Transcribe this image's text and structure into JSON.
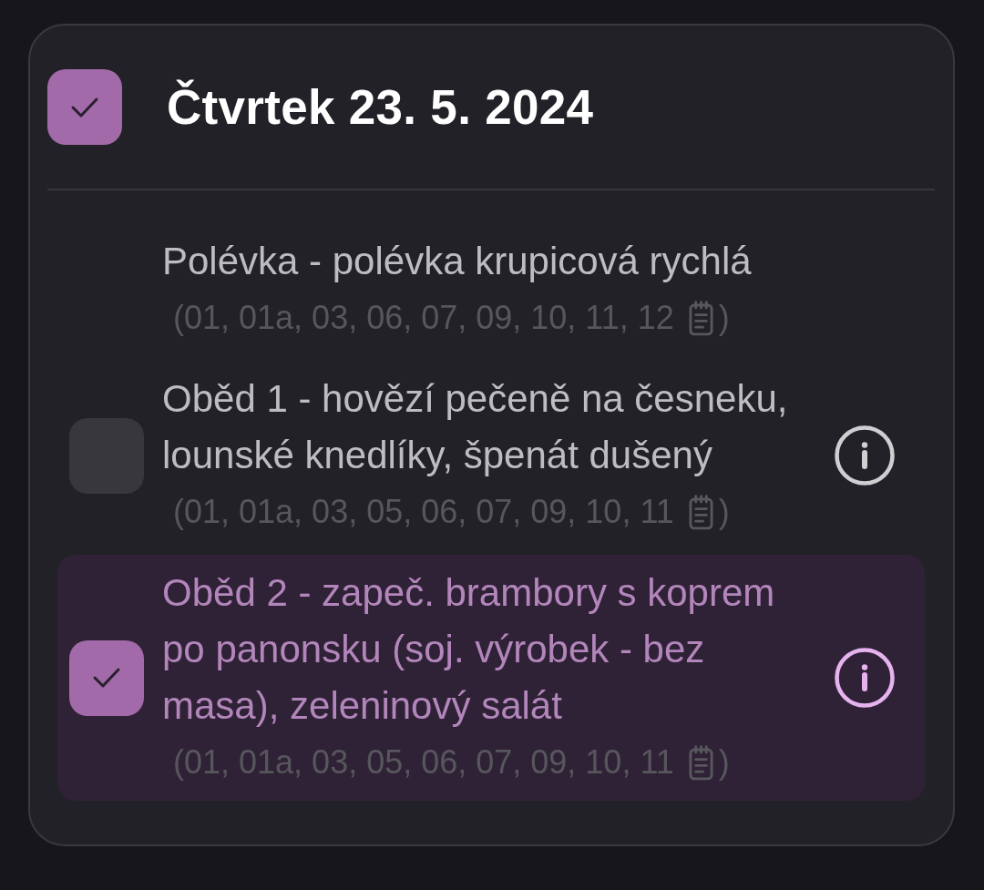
{
  "day": {
    "title": "Čtvrtek 23. 5. 2024",
    "checked": true
  },
  "items": [
    {
      "kind": "soup",
      "checked": false,
      "name": "Polévka - polévka krupicová rychlá",
      "allergens": "(01, 01a, 03, 06, 07, 09, 10, 11, 12",
      "allergens_end": ")"
    },
    {
      "kind": "meal",
      "checked": false,
      "name": "Oběd 1 - hovězí pečeně na česneku, lounské knedlíky, špenát dušený",
      "allergens": "(01, 01a, 03, 05, 06, 07, 09, 10, 11",
      "allergens_end": ")"
    },
    {
      "kind": "meal",
      "checked": true,
      "name": "Oběd 2 - zapeč. brambory s koprem po panonsku (soj. výrobek - bez masa), zeleninový salát",
      "allergens": "(01, 01a, 03, 05, 06, 07, 09, 10, 11",
      "allergens_end": ")"
    }
  ]
}
